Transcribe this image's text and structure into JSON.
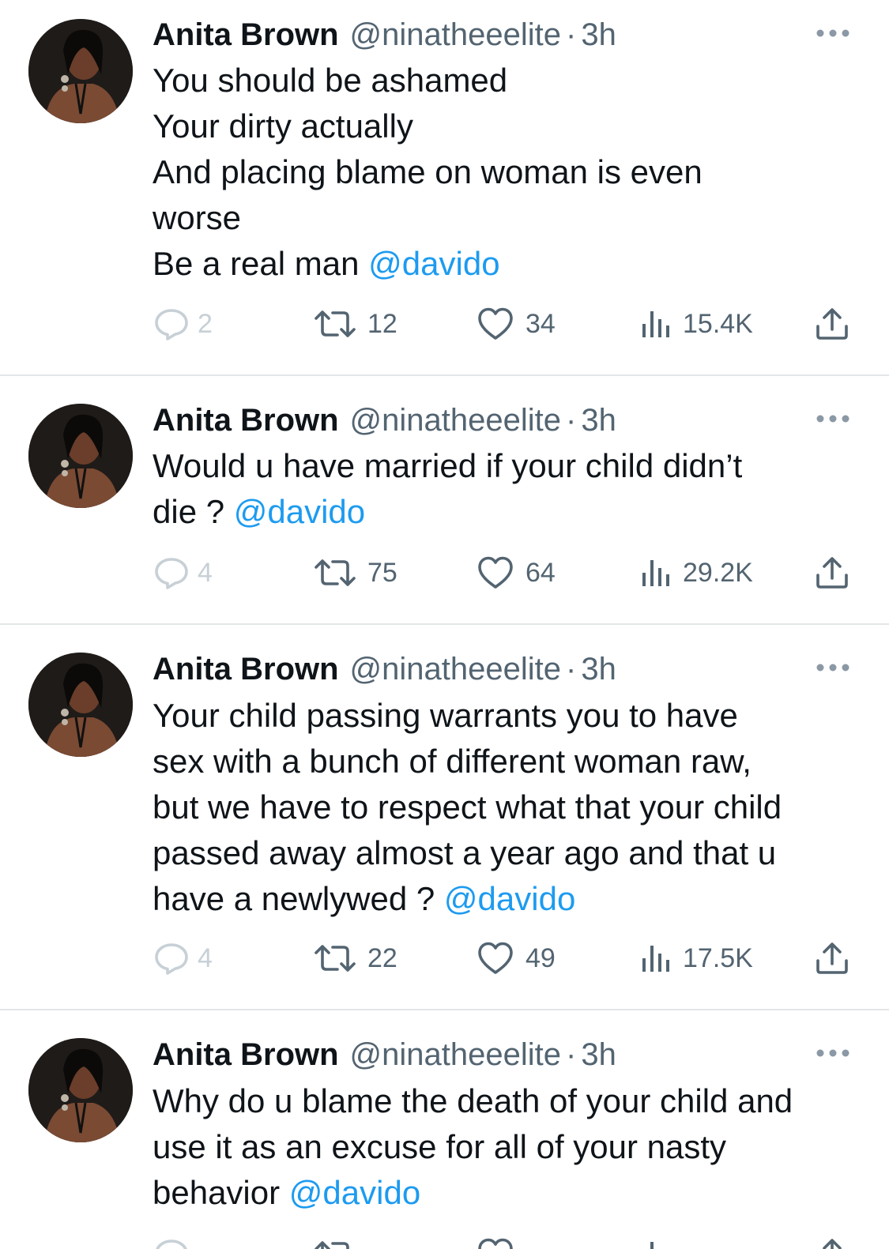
{
  "author": {
    "name": "Anita Brown",
    "handle": "@ninatheeelite",
    "dot": "·",
    "time": "3h"
  },
  "tweets": [
    {
      "lines": [
        {
          "text": "You should be ashamed",
          "mention": ""
        },
        {
          "text": "Your dirty actually",
          "mention": ""
        },
        {
          "text": "And placing blame on woman is even",
          "mention": ""
        },
        {
          "text": "worse",
          "mention": ""
        },
        {
          "text": "Be a real man ",
          "mention": "@davido"
        }
      ],
      "replies": "2",
      "retweets": "12",
      "likes": "34",
      "views": "15.4K"
    },
    {
      "lines": [
        {
          "text": "Would u have married if your child didn’t",
          "mention": ""
        },
        {
          "text": "die ? ",
          "mention": "@davido"
        }
      ],
      "replies": "4",
      "retweets": "75",
      "likes": "64",
      "views": "29.2K"
    },
    {
      "lines": [
        {
          "text": "Your child passing warrants you to have",
          "mention": ""
        },
        {
          "text": "sex with a bunch of different woman raw,",
          "mention": ""
        },
        {
          "text": "but we have to respect what that your child",
          "mention": ""
        },
        {
          "text": "passed away almost a year ago and that u",
          "mention": ""
        },
        {
          "text": "have a newlywed ? ",
          "mention": "@davido"
        }
      ],
      "replies": "4",
      "retweets": "22",
      "likes": "49",
      "views": "17.5K"
    },
    {
      "lines": [
        {
          "text": "Why do u blame the death of your child and",
          "mention": ""
        },
        {
          "text": "use it as an excuse for all of your nasty",
          "mention": ""
        },
        {
          "text": "behavior ",
          "mention": "@davido"
        }
      ],
      "replies": "",
      "retweets": "",
      "likes": "",
      "views": ""
    }
  ],
  "icons": {
    "more": "more-dots-icon",
    "reply": "reply-bubble-icon",
    "retweet": "retweet-icon",
    "like": "heart-icon",
    "views": "views-bars-icon",
    "share": "share-upload-icon"
  },
  "colors": {
    "mention": "#1d9bf0",
    "secondary": "#536471",
    "faded": "#c7d0d6",
    "divider": "#e3e6e8"
  }
}
